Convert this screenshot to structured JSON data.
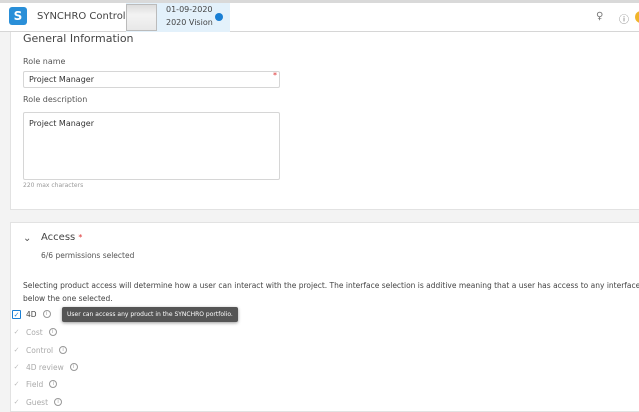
{
  "header": {
    "app_title": "SYNCHRO Control",
    "project_date": "01-09-2020",
    "project_name": "2020 Vision",
    "avatar_color": "#f0b429"
  },
  "general": {
    "title": "General Information",
    "role_name_label": "Role name",
    "role_name_value": "Project Manager",
    "role_desc_label": "Role description",
    "role_desc_value": "Project Manager",
    "max_chars": "220 max characters"
  },
  "access": {
    "title": "Access",
    "required": "*",
    "permissions": "6/6 permissions selected",
    "description": "Selecting product access will determine how a user can interact with the project. The interface selection is additive meaning that a user has access to any interface below the one selected.",
    "items": [
      {
        "label": "4D",
        "checked": true
      },
      {
        "label": "Cost",
        "checked": true
      },
      {
        "label": "Control",
        "checked": true
      },
      {
        "label": "4D review",
        "checked": true
      },
      {
        "label": "Field",
        "checked": true
      },
      {
        "label": "Guest",
        "checked": true
      }
    ],
    "tooltip": "User can access any product in the SYNCHRO portfolio."
  }
}
